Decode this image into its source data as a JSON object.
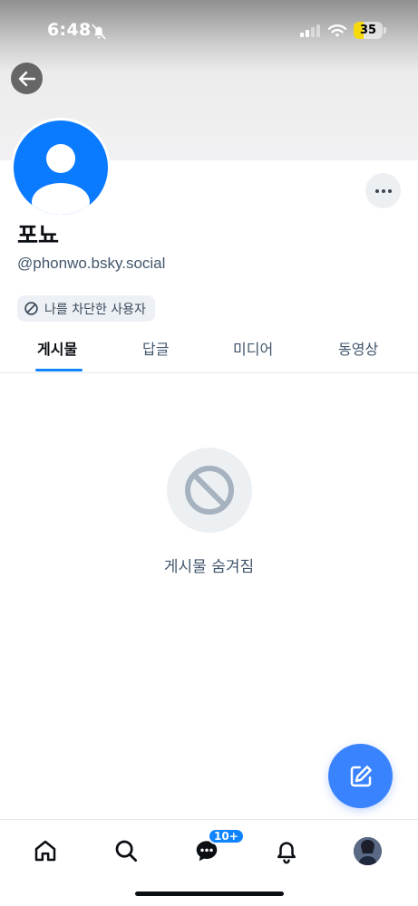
{
  "status_bar": {
    "time": "6:48",
    "battery_level": "35",
    "battery_fraction": 0.35,
    "icons": [
      "bell-off-icon",
      "signal-icon",
      "wifi-icon",
      "battery-icon"
    ]
  },
  "header": {
    "back_icon": "arrow-left-icon"
  },
  "profile": {
    "display_name": "포뇨",
    "handle": "@phonwo.bsky.social",
    "blocked_badge": "나를 차단한 사용자",
    "avatar_color": "#0a7aff"
  },
  "tabs": [
    {
      "label": "게시물",
      "active": true
    },
    {
      "label": "답글",
      "active": false
    },
    {
      "label": "미디어",
      "active": false
    },
    {
      "label": "동영상",
      "active": false
    }
  ],
  "empty_state": {
    "icon": "prohibited-icon",
    "message": "게시물 숨겨짐"
  },
  "compose": {
    "icon": "compose-icon"
  },
  "bottom_nav": {
    "items": [
      "home-icon",
      "search-icon",
      "chat-icon",
      "bell-icon",
      "profile-avatar"
    ],
    "chat_badge": "10+"
  },
  "colors": {
    "accent": "#1083fe",
    "compose": "#3a83ff",
    "muted_text": "#42566c"
  }
}
